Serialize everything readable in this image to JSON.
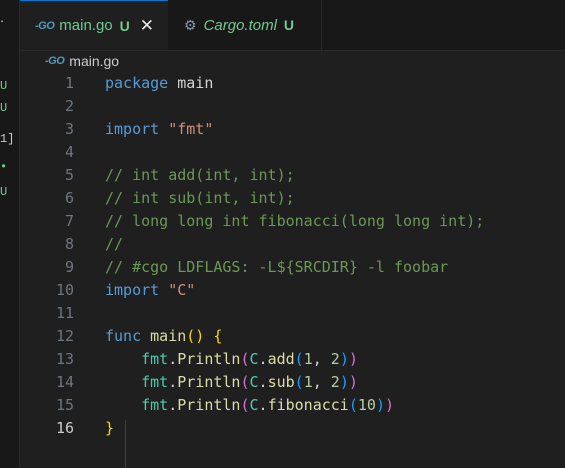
{
  "tabs": [
    {
      "icon": "go-icon",
      "glyph": "-GO",
      "label": "main.go",
      "status": "U",
      "active": true
    },
    {
      "icon": "gear-icon",
      "glyph": "⚙",
      "label": "Cargo.toml",
      "status": "U",
      "active": false
    }
  ],
  "breadcrumb": {
    "glyph": "-GO",
    "file": "main.go"
  },
  "side_marks": [
    "U",
    "U",
    "1]",
    "•",
    "U"
  ],
  "current_line": 16,
  "lines": [
    {
      "n": "1",
      "tokens": [
        {
          "t": "package",
          "c": "kw"
        },
        {
          "t": " ",
          "c": "pl"
        },
        {
          "t": "main",
          "c": "id"
        }
      ]
    },
    {
      "n": "2",
      "tokens": []
    },
    {
      "n": "3",
      "tokens": [
        {
          "t": "import",
          "c": "kw"
        },
        {
          "t": " ",
          "c": "pl"
        },
        {
          "t": "\"fmt\"",
          "c": "str"
        }
      ]
    },
    {
      "n": "4",
      "tokens": []
    },
    {
      "n": "5",
      "tokens": [
        {
          "t": "// int add(int, int);",
          "c": "com"
        }
      ]
    },
    {
      "n": "6",
      "tokens": [
        {
          "t": "// int sub(int, int);",
          "c": "com"
        }
      ]
    },
    {
      "n": "7",
      "tokens": [
        {
          "t": "// long long int fibonacci(long long int);",
          "c": "com"
        }
      ]
    },
    {
      "n": "8",
      "tokens": [
        {
          "t": "//",
          "c": "com"
        }
      ]
    },
    {
      "n": "9",
      "tokens": [
        {
          "t": "// #cgo LDFLAGS: -L${SRCDIR} -l foobar",
          "c": "com"
        }
      ]
    },
    {
      "n": "10",
      "tokens": [
        {
          "t": "import",
          "c": "kw"
        },
        {
          "t": " ",
          "c": "pl"
        },
        {
          "t": "\"C\"",
          "c": "str"
        }
      ]
    },
    {
      "n": "11",
      "tokens": []
    },
    {
      "n": "12",
      "tokens": [
        {
          "t": "func",
          "c": "kw"
        },
        {
          "t": " ",
          "c": "pl"
        },
        {
          "t": "main",
          "c": "fn"
        },
        {
          "t": "()",
          "c": "b1"
        },
        {
          "t": " ",
          "c": "pl"
        },
        {
          "t": "{",
          "c": "b1"
        }
      ]
    },
    {
      "n": "13",
      "tokens": [
        {
          "t": "    ",
          "c": "pl"
        },
        {
          "t": "fmt",
          "c": "pkg"
        },
        {
          "t": ".",
          "c": "pl"
        },
        {
          "t": "Println",
          "c": "fn"
        },
        {
          "t": "(",
          "c": "b2"
        },
        {
          "t": "C",
          "c": "pkg"
        },
        {
          "t": ".",
          "c": "pl"
        },
        {
          "t": "add",
          "c": "fn"
        },
        {
          "t": "(",
          "c": "b3"
        },
        {
          "t": "1",
          "c": "num"
        },
        {
          "t": ", ",
          "c": "pl"
        },
        {
          "t": "2",
          "c": "num"
        },
        {
          "t": ")",
          "c": "b3"
        },
        {
          "t": ")",
          "c": "b2"
        }
      ]
    },
    {
      "n": "14",
      "tokens": [
        {
          "t": "    ",
          "c": "pl"
        },
        {
          "t": "fmt",
          "c": "pkg"
        },
        {
          "t": ".",
          "c": "pl"
        },
        {
          "t": "Println",
          "c": "fn"
        },
        {
          "t": "(",
          "c": "b2"
        },
        {
          "t": "C",
          "c": "pkg"
        },
        {
          "t": ".",
          "c": "pl"
        },
        {
          "t": "sub",
          "c": "fn"
        },
        {
          "t": "(",
          "c": "b3"
        },
        {
          "t": "1",
          "c": "num"
        },
        {
          "t": ", ",
          "c": "pl"
        },
        {
          "t": "2",
          "c": "num"
        },
        {
          "t": ")",
          "c": "b3"
        },
        {
          "t": ")",
          "c": "b2"
        }
      ]
    },
    {
      "n": "15",
      "tokens": [
        {
          "t": "    ",
          "c": "pl"
        },
        {
          "t": "fmt",
          "c": "pkg"
        },
        {
          "t": ".",
          "c": "pl"
        },
        {
          "t": "Println",
          "c": "fn"
        },
        {
          "t": "(",
          "c": "b2"
        },
        {
          "t": "C",
          "c": "pkg"
        },
        {
          "t": ".",
          "c": "pl"
        },
        {
          "t": "fibonacci",
          "c": "fn"
        },
        {
          "t": "(",
          "c": "b3"
        },
        {
          "t": "10",
          "c": "num"
        },
        {
          "t": ")",
          "c": "b3"
        },
        {
          "t": ")",
          "c": "b2"
        }
      ]
    },
    {
      "n": "16",
      "tokens": [
        {
          "t": "}",
          "c": "b1"
        }
      ]
    }
  ],
  "colors": {
    "background": "#1f1f1f",
    "accent": "#0078d4",
    "untracked": "#73c991"
  }
}
